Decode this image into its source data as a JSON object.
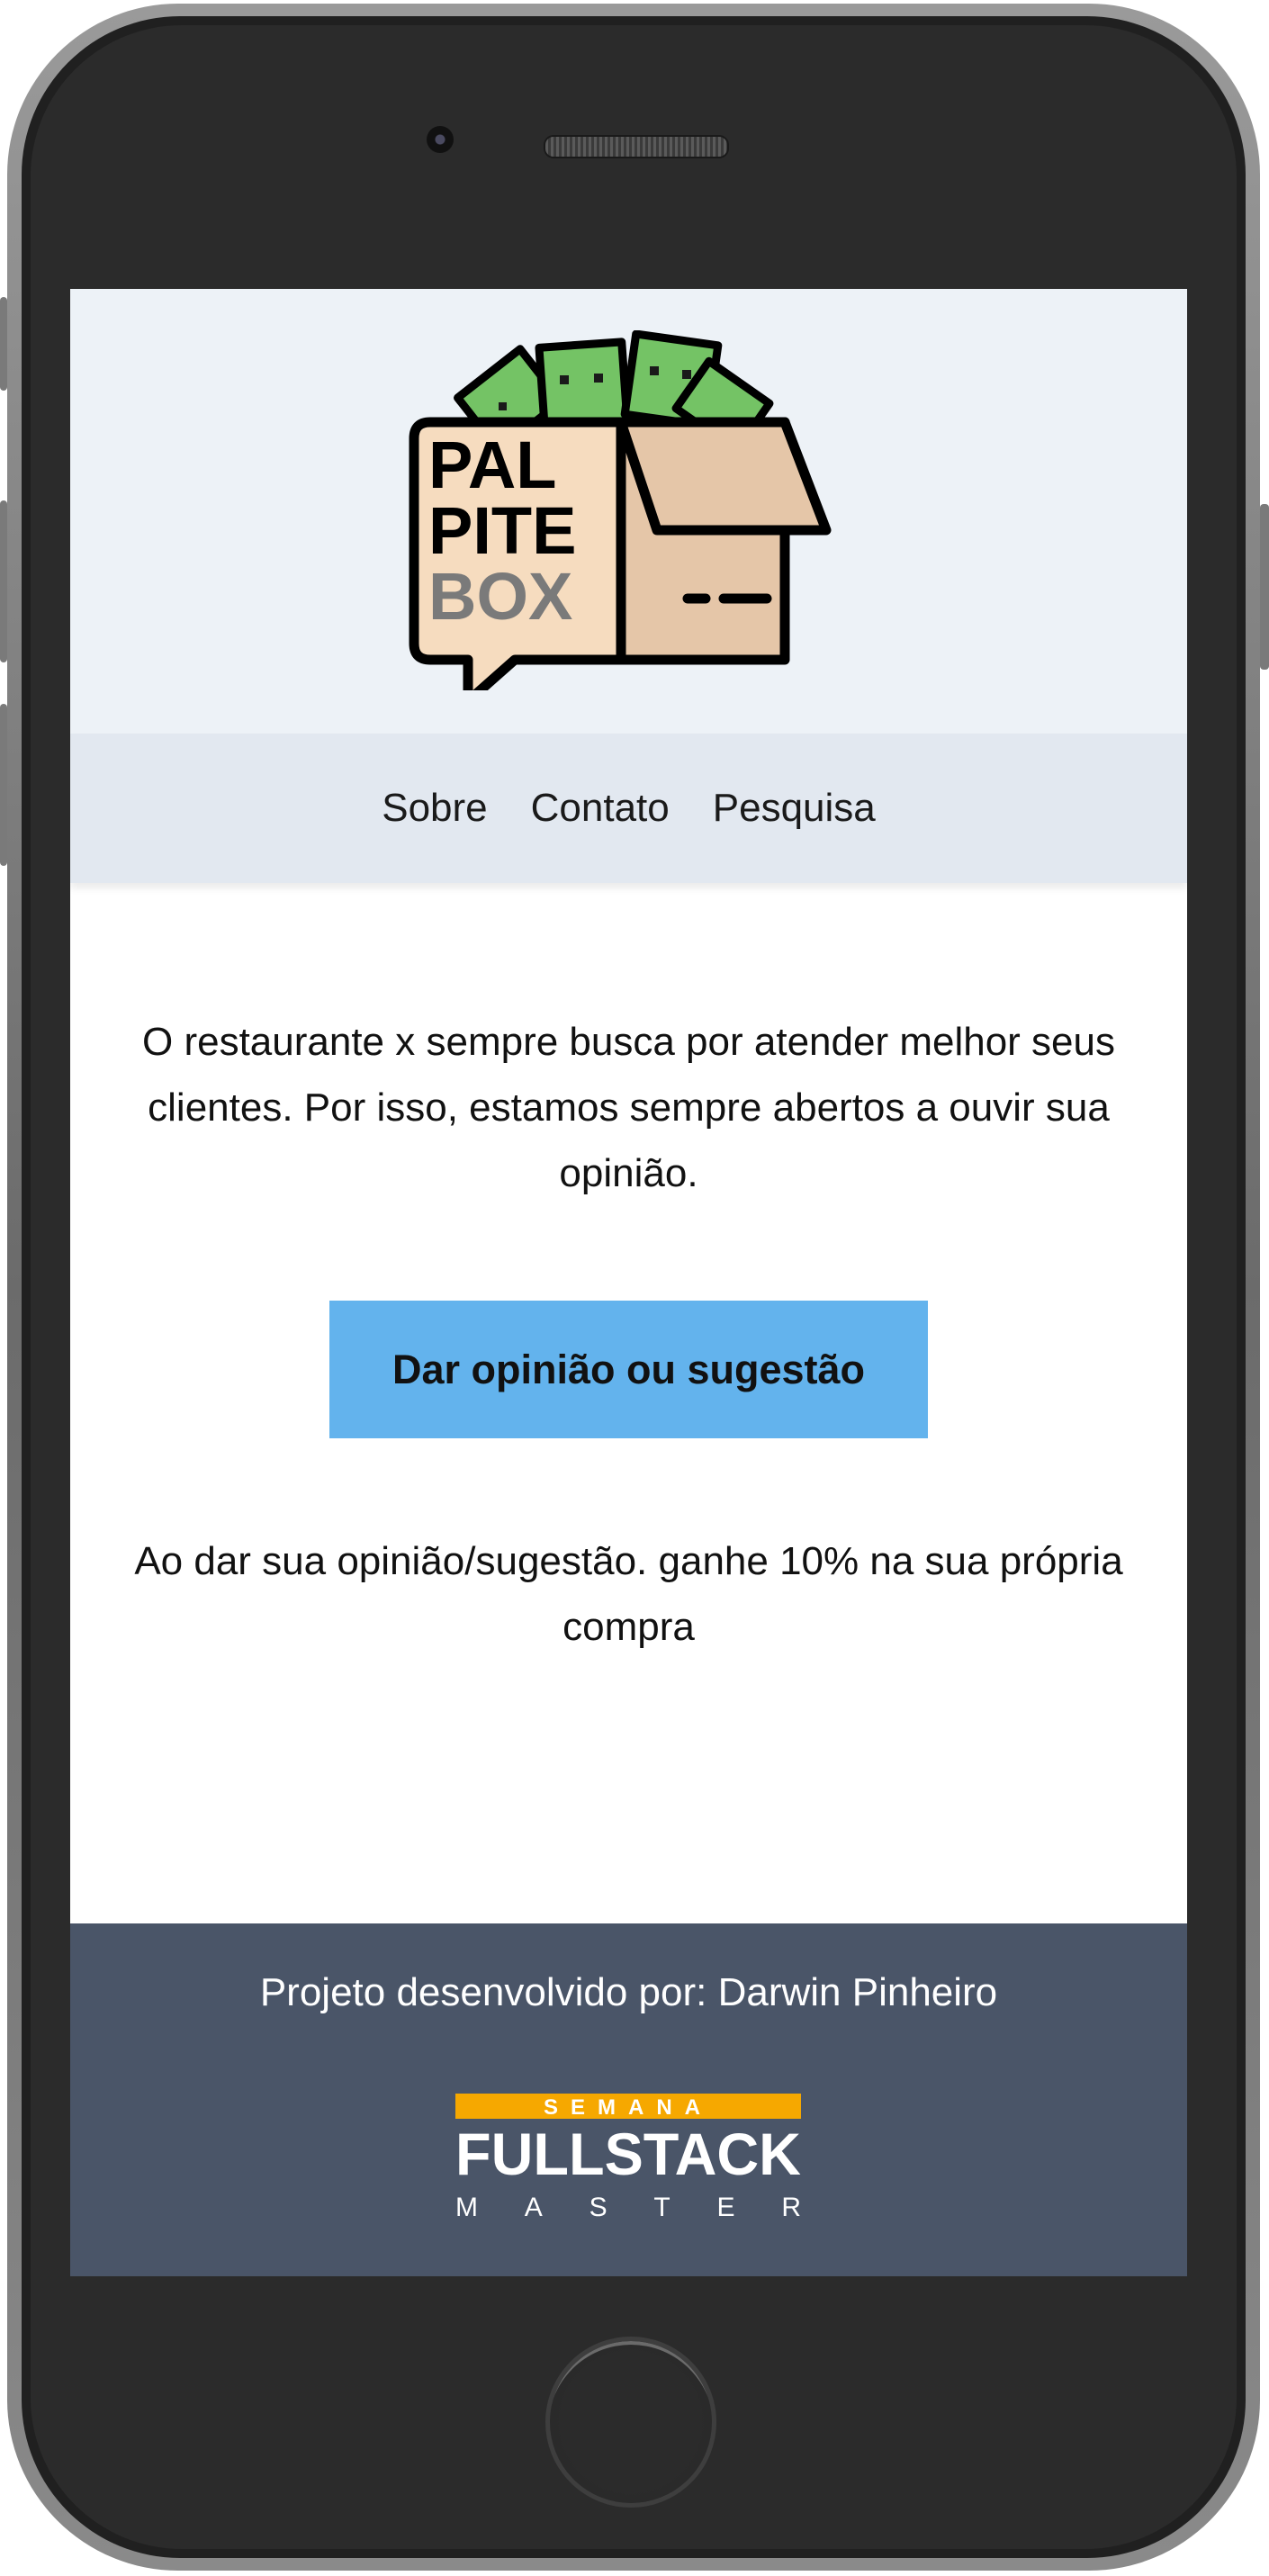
{
  "header": {
    "logo_lines": [
      "PAL",
      "PITE",
      "BOX"
    ]
  },
  "nav": {
    "items": [
      {
        "label": "Sobre"
      },
      {
        "label": "Contato"
      },
      {
        "label": "Pesquisa"
      }
    ]
  },
  "main": {
    "intro": "O restaurante x sempre busca por atender melhor seus clientes. Por isso, estamos sempre abertos a ouvir sua opinião.",
    "cta_label": "Dar opinião ou sugestão",
    "promo": "Ao dar sua opinião/sugestão. ganhe 10% na sua própria compra"
  },
  "footer": {
    "credit": "Projeto desenvolvido por: Darwin Pinheiro",
    "brand_top": "SEMANA",
    "brand_main": "FULLSTACK",
    "brand_bottom": "MASTER"
  },
  "colors": {
    "header_bg": "#edf2f7",
    "nav_bg": "#e2e8f0",
    "cta_bg": "#63b3ed",
    "footer_bg": "#4a5568",
    "brand_accent": "#f6a800"
  }
}
